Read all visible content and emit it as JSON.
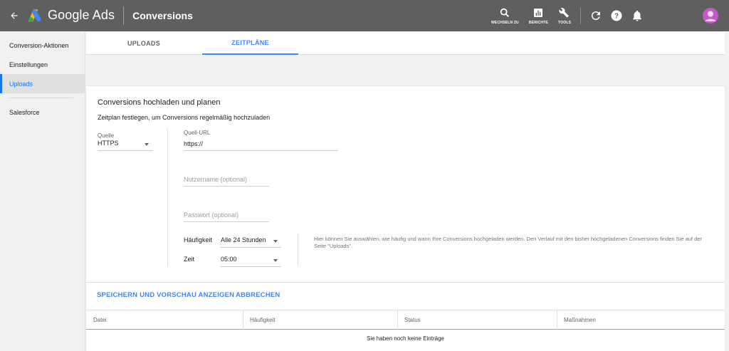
{
  "app": {
    "brand": "Google Ads",
    "page_title": "Conversions"
  },
  "topbar": {
    "tools": [
      {
        "label": "WECHSELN ZU",
        "icon": "search-icon"
      },
      {
        "label": "BERICHTE",
        "icon": "reports-icon"
      },
      {
        "label": "TOOLS",
        "icon": "wrench-icon"
      }
    ],
    "icons": [
      "refresh-icon",
      "help-icon",
      "notifications-icon",
      "avatar"
    ]
  },
  "sidebar": {
    "items": [
      {
        "label": "Conversion-Aktionen",
        "active": false
      },
      {
        "label": "Einstellungen",
        "active": false
      },
      {
        "label": "Uploads",
        "active": true
      },
      {
        "label": "Salesforce",
        "active": false
      }
    ]
  },
  "tabs": [
    {
      "label": "UPLOADS",
      "active": false
    },
    {
      "label": "ZEITPLÄNE",
      "active": true
    }
  ],
  "form": {
    "heading": "Conversions hochladen und planen",
    "subheading": "Zeitplan festlegen, um Conversions regelmäßig hochzuladen",
    "source_label": "Quelle",
    "source_value": "HTTPS",
    "url_label": "Quell-URL",
    "url_value": "https://",
    "username_placeholder": "Nutzername (optional)",
    "password_placeholder": "Passwort (optional)",
    "frequency_label": "Häufigkeit",
    "frequency_value": "Alle 24 Stunden",
    "time_label": "Zeit",
    "time_value": "05:00",
    "help_text": "Hier können Sie auswählen, wie häufig und wann Ihre Conversions hochgeladen werden. Den Verlauf mit den bisher hochgeladenen Conversions finden Sie auf der Seite \"Uploads\"."
  },
  "actions": {
    "save": "SPEICHERN UND VORSCHAU ANZEIGEN",
    "cancel": "ABBRECHEN"
  },
  "table": {
    "columns": [
      "Datei",
      "Häufigkeit",
      "Status",
      "Maßnahmen"
    ],
    "empty_message": "Sie haben noch keine Einträge"
  },
  "colors": {
    "topbar": "#5f5f5f",
    "accent": "#4285f4",
    "avatar": "#c659c9"
  }
}
